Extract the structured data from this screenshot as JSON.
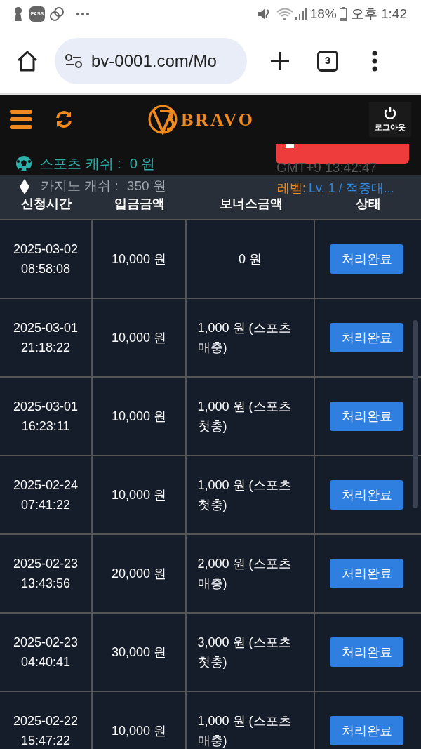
{
  "status_bar": {
    "time": "오후 1:42",
    "battery": "18%",
    "notification_icons": [
      "PASS"
    ]
  },
  "browser": {
    "url": "bv-0001.com/Mo",
    "tab_count": "3"
  },
  "header": {
    "brand": "BRAVO",
    "logout": "로그아웃"
  },
  "info": {
    "sports_cash_label": "스포츠 캐쉬 :",
    "sports_cash_value": "0 원",
    "clock": "GMT+9 13:42:47",
    "casino_cash_label": "카지노 캐쉬 :",
    "casino_cash_value": "350 원",
    "level_label": "레벨:",
    "level_value": "Lv. 1 / 적중대..."
  },
  "table": {
    "columns": [
      "신청시간",
      "입금금액",
      "보너스금액",
      "상태"
    ],
    "rows": [
      {
        "date": "2025-03-02",
        "time": "08:58:08",
        "deposit": "10,000 원",
        "bonus": "0 원",
        "status": "처리완료"
      },
      {
        "date": "2025-03-01",
        "time": "21:18:22",
        "deposit": "10,000 원",
        "bonus": "1,000 원 (스포츠 매충)",
        "status": "처리완료"
      },
      {
        "date": "2025-03-01",
        "time": "16:23:11",
        "deposit": "10,000 원",
        "bonus": "1,000 원 (스포츠 첫충)",
        "status": "처리완료"
      },
      {
        "date": "2025-02-24",
        "time": "07:41:22",
        "deposit": "10,000 원",
        "bonus": "1,000 원 (스포츠 첫충)",
        "status": "처리완료"
      },
      {
        "date": "2025-02-23",
        "time": "13:43:56",
        "deposit": "20,000 원",
        "bonus": "2,000 원 (스포츠 매충)",
        "status": "처리완료"
      },
      {
        "date": "2025-02-23",
        "time": "04:40:41",
        "deposit": "30,000 원",
        "bonus": "3,000 원 (스포츠 첫충)",
        "status": "처리완료"
      },
      {
        "date": "2025-02-22",
        "time": "15:47:22",
        "deposit": "10,000 원",
        "bonus": "1,000 원 (스포츠 매충)",
        "status": "처리완료"
      }
    ]
  }
}
